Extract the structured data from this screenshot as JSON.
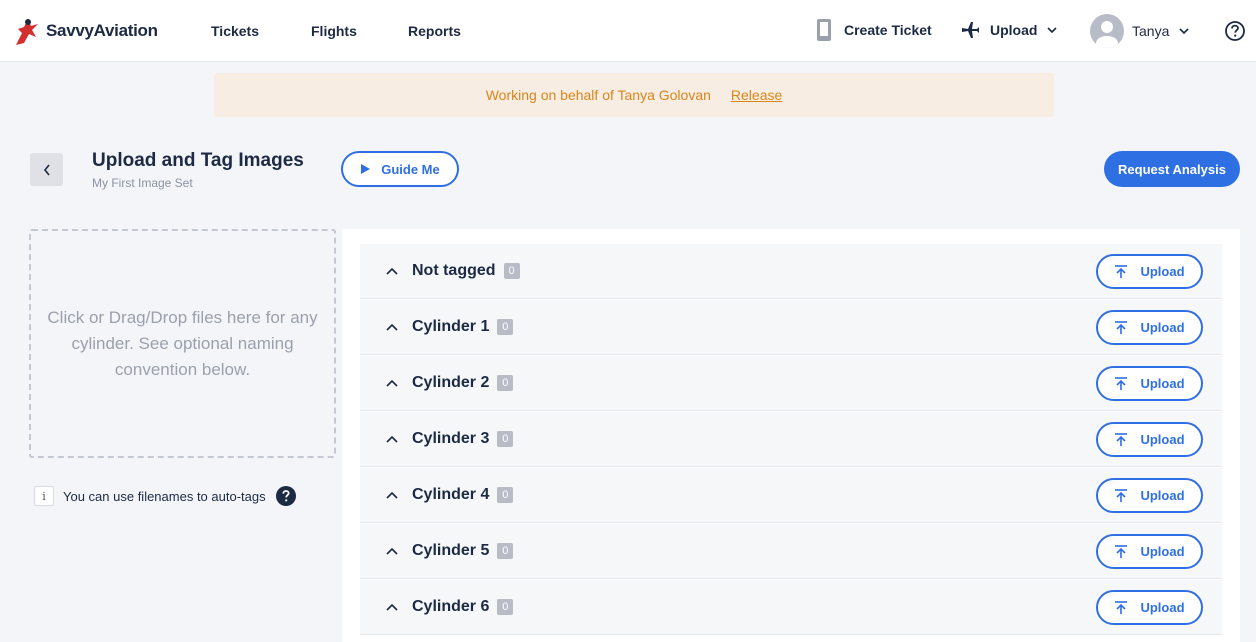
{
  "brand": {
    "name": "SavvyAviation"
  },
  "nav": {
    "tickets": "Tickets",
    "flights": "Flights",
    "reports": "Reports"
  },
  "header": {
    "create_ticket": "Create Ticket",
    "upload": "Upload",
    "user_name": "Tanya"
  },
  "banner": {
    "message": "Working on behalf of Tanya Golovan",
    "release": "Release"
  },
  "page": {
    "title": "Upload and Tag Images",
    "subtitle": "My First Image Set",
    "guide_me": "Guide Me",
    "request_analysis": "Request Analysis"
  },
  "dropzone": {
    "text": "Click or Drag/Drop files here for any cylinder. See optional naming convention below."
  },
  "hint": {
    "info_glyph": "i",
    "text": "You can use filenames to auto-tags"
  },
  "groups": [
    {
      "label": "Not tagged",
      "count": "0",
      "button": "Upload"
    },
    {
      "label": "Cylinder 1",
      "count": "0",
      "button": "Upload"
    },
    {
      "label": "Cylinder 2",
      "count": "0",
      "button": "Upload"
    },
    {
      "label": "Cylinder 3",
      "count": "0",
      "button": "Upload"
    },
    {
      "label": "Cylinder 4",
      "count": "0",
      "button": "Upload"
    },
    {
      "label": "Cylinder 5",
      "count": "0",
      "button": "Upload"
    },
    {
      "label": "Cylinder 6",
      "count": "0",
      "button": "Upload"
    }
  ],
  "colors": {
    "accent": "#2f6fe4",
    "text": "#1c2a44",
    "banner_bg": "#f7ede2",
    "banner_text": "#d9861b",
    "logo_red": "#d32f2f"
  },
  "icons": {
    "logo": "savvy-aviation-logo",
    "create_ticket": "phone-ticket-icon",
    "upload": "airplane-icon",
    "user_dropdown": "chevron-down-icon",
    "help": "question-circle-icon",
    "back": "chevron-left-icon",
    "guide": "play-icon",
    "group_toggle": "chevron-up-icon",
    "group_upload": "upload-arrow-icon"
  }
}
